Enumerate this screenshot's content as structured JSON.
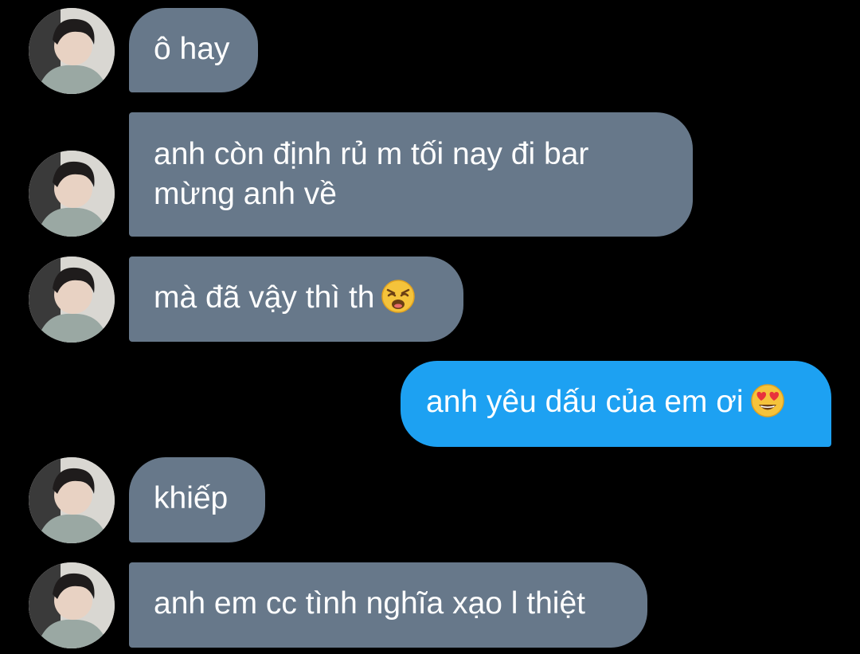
{
  "conversation": {
    "messages": [
      {
        "sender": "other",
        "text": "ô hay"
      },
      {
        "sender": "other",
        "text": "anh còn định rủ m tối nay đi bar mừng anh về"
      },
      {
        "sender": "other",
        "text": "mà đã vậy thì th",
        "emoji": "weary-face"
      },
      {
        "sender": "self",
        "text": "anh yêu dấu của em ơi",
        "emoji": "heart-eyes-face"
      },
      {
        "sender": "other",
        "text": "khiếp"
      },
      {
        "sender": "other",
        "text": "anh em cc tình nghĩa xạo l thiệt"
      }
    ]
  },
  "colors": {
    "background": "#000000",
    "incoming_bubble": "#67788a",
    "outgoing_bubble": "#1da1f2",
    "text": "#ffffff"
  }
}
